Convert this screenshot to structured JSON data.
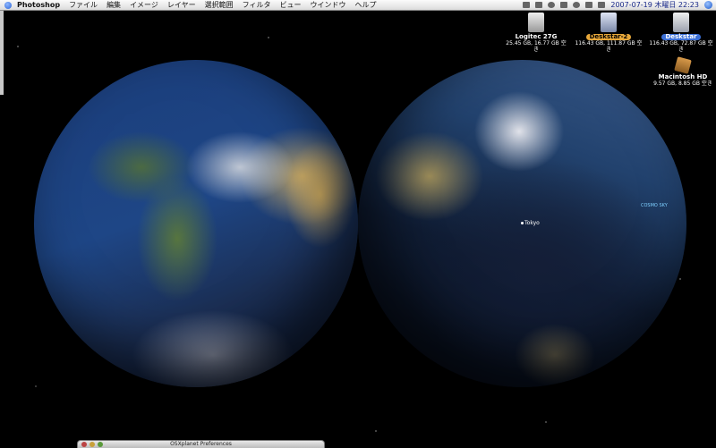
{
  "menubar": {
    "app_name": "Photoshop",
    "menus": [
      "ファイル",
      "編集",
      "イメージ",
      "レイヤー",
      "選択範囲",
      "フィルタ",
      "ビュー",
      "ウインドウ",
      "ヘルプ"
    ],
    "clock": "2007-07-19 木曜日 22:23"
  },
  "desktop": {
    "drives": [
      {
        "name": "Logitec 27G",
        "info": "25.45 GB, 16.77 GB 空き"
      },
      {
        "name": "Deskstar-2",
        "info": "116.43 GB, 111.87 GB 空き"
      },
      {
        "name": "Deskstar",
        "info": "116.43 GB, 72.87 GB 空き"
      },
      {
        "name": "Macintosh HD",
        "info": "9.57 GB, 8.85 GB 空き"
      }
    ],
    "city_label": "Tokyo",
    "cosmo_label": "COSMO SKY"
  },
  "window": {
    "title": "OSXplanet Preferences"
  },
  "colors": {
    "menubar": "#e6e6e6",
    "clock_text": "#1a2a8a",
    "deskstar2_label": "#e8a83a",
    "deskstar_label": "#3b6fd6"
  }
}
